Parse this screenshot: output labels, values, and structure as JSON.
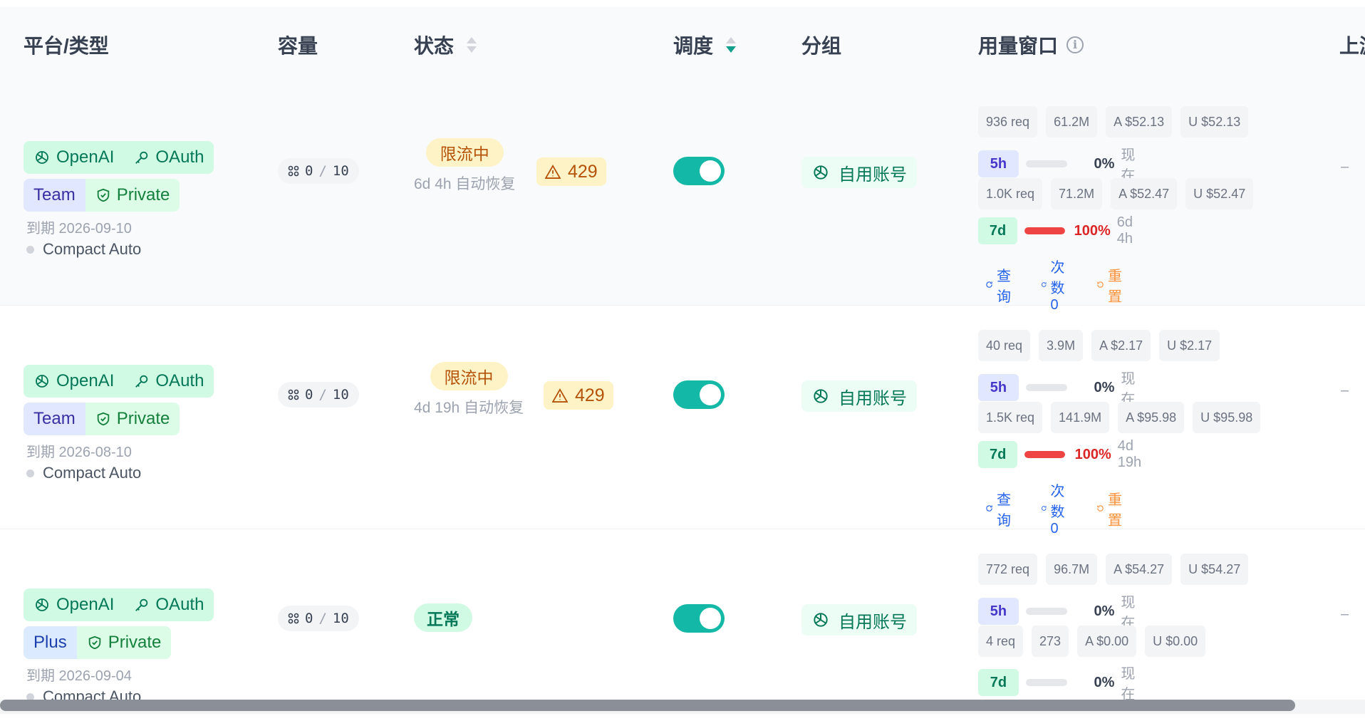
{
  "headers": {
    "platform_type": "平台/类型",
    "capacity": "容量",
    "status": "状态",
    "schedule": "调度",
    "group": "分组",
    "usage_window": "用量窗口",
    "upstream": "上游"
  },
  "rows": [
    {
      "platform": "OpenAI",
      "auth": "OAuth",
      "tier": "Team",
      "visibility": "Private",
      "expiry": "到期 2026-09-10",
      "mode": "Compact Auto",
      "capacity_used": "0",
      "capacity_sep": "/",
      "capacity_total": "10",
      "status": "限流中",
      "recover": "6d 4h 自动恢复",
      "error_code": "429",
      "schedule_enabled": true,
      "group": "自用账号",
      "usage_5h": {
        "req": "936 req",
        "tokens": "61.2M",
        "a": "A $52.13",
        "u": "U $52.13",
        "window": "5h",
        "pct": "0%",
        "when": "现在",
        "fill": 0
      },
      "usage_7d": {
        "req": "1.0K req",
        "tokens": "71.2M",
        "a": "A $52.47",
        "u": "U $52.47",
        "window": "7d",
        "pct": "100%",
        "when": "6d 4h",
        "fill": 1
      },
      "actions": {
        "query": "查询",
        "count": "次数 0",
        "reset": "重置"
      },
      "last": "–"
    },
    {
      "platform": "OpenAI",
      "auth": "OAuth",
      "tier": "Team",
      "visibility": "Private",
      "expiry": "到期 2026-08-10",
      "mode": "Compact Auto",
      "capacity_used": "0",
      "capacity_sep": "/",
      "capacity_total": "10",
      "status": "限流中",
      "recover": "4d 19h 自动恢复",
      "error_code": "429",
      "schedule_enabled": true,
      "group": "自用账号",
      "usage_5h": {
        "req": "40 req",
        "tokens": "3.9M",
        "a": "A $2.17",
        "u": "U $2.17",
        "window": "5h",
        "pct": "0%",
        "when": "现在",
        "fill": 0
      },
      "usage_7d": {
        "req": "1.5K req",
        "tokens": "141.9M",
        "a": "A $95.98",
        "u": "U $95.98",
        "window": "7d",
        "pct": "100%",
        "when": "4d 19h",
        "fill": 1
      },
      "actions": {
        "query": "查询",
        "count": "次数 0",
        "reset": "重置"
      },
      "last": "–"
    },
    {
      "platform": "OpenAI",
      "auth": "OAuth",
      "tier": "Plus",
      "visibility": "Private",
      "expiry": "到期 2026-09-04",
      "mode": "Compact Auto",
      "capacity_used": "0",
      "capacity_sep": "/",
      "capacity_total": "10",
      "status": "正常",
      "schedule_enabled": true,
      "group": "自用账号",
      "usage_5h": {
        "req": "772 req",
        "tokens": "96.7M",
        "a": "A $54.27",
        "u": "U $54.27",
        "window": "5h",
        "pct": "0%",
        "when": "现在",
        "fill": 0
      },
      "usage_7d": {
        "req": "4 req",
        "tokens": "273",
        "a": "A $0.00",
        "u": "U $0.00",
        "window": "7d",
        "pct": "0%",
        "when": "现在",
        "fill": 0
      },
      "last": "–"
    }
  ]
}
